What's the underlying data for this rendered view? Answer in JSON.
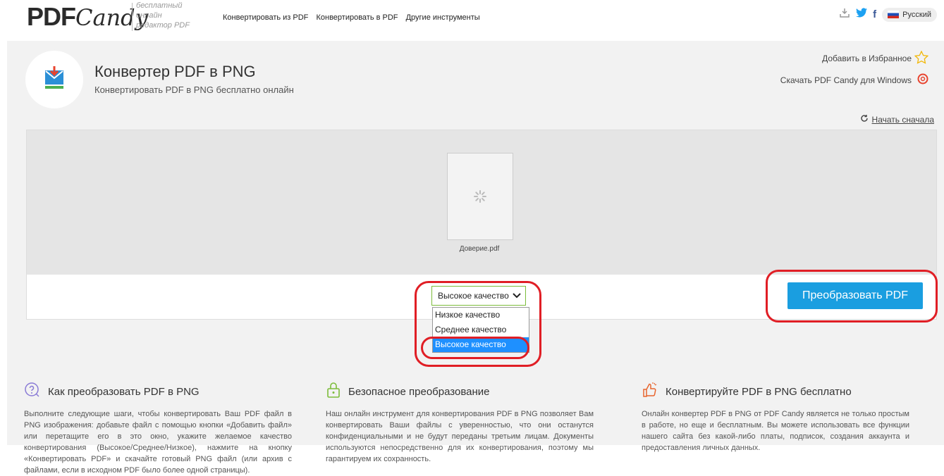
{
  "header": {
    "logo_pdf": "PDF",
    "logo_candy": "Candy",
    "tagline": "бесплатный онлайн редактор PDF",
    "nav": [
      "Конвертировать из PDF",
      "Конвертировать в PDF",
      "Другие инструменты"
    ],
    "language": "Русский"
  },
  "tool": {
    "title": "Конвертер PDF в PNG",
    "subtitle": "Конвертировать PDF в PNG бесплатно онлайн",
    "favorite": "Добавить в Избранное",
    "download_windows": "Скачать PDF Candy для Windows",
    "restart": "Начать сначала"
  },
  "file": {
    "name": "Доверие.pdf"
  },
  "quality": {
    "selected": "Высокое качество",
    "options": [
      "Низкое качество",
      "Среднее качество",
      "Высокое качество"
    ]
  },
  "convert_button": "Преобразовать PDF",
  "info": [
    {
      "icon": "question-icon",
      "title": "Как преобразовать PDF в PNG",
      "text": "Выполните следующие шаги, чтобы конвертировать Ваш PDF файл в PNG изображения: добавьте файл с помощью кнопки «Добавить файл» или перетащите его в это окно, укажите желаемое качество конвертирования (Высокое/Среднее/Низкое), нажмите на кнопку «Конвертировать PDF» и скачайте готовый PNG файл (или архив с файлами, если в исходном PDF было более одной страницы)."
    },
    {
      "icon": "lock-icon",
      "title": "Безопасное преобразование",
      "text": "Наш онлайн инструмент для конвертирования PDF в PNG позволяет Вам конвертировать Ваши файлы с уверенностью, что они останутся конфиденциальными и не будут переданы третьим лицам. Документы используются непосредственно для их конвертирования, поэтому мы гарантируем их сохранность."
    },
    {
      "icon": "thumbs-up-icon",
      "title": "Конвертируйте PDF в PNG бесплатно",
      "text": "Онлайн конвертер PDF в PNG от PDF Candy является не только простым в работе, но еще и бесплатным. Вы можете использовать все функции нашего сайта без какой-либо платы, подписок, создания аккаунта и предоставления личных данных."
    }
  ],
  "colors": {
    "accent": "#1a9ee0",
    "highlight": "#e01e25",
    "select_border": "#7cbc3a",
    "selected_option": "#1e90ff"
  }
}
